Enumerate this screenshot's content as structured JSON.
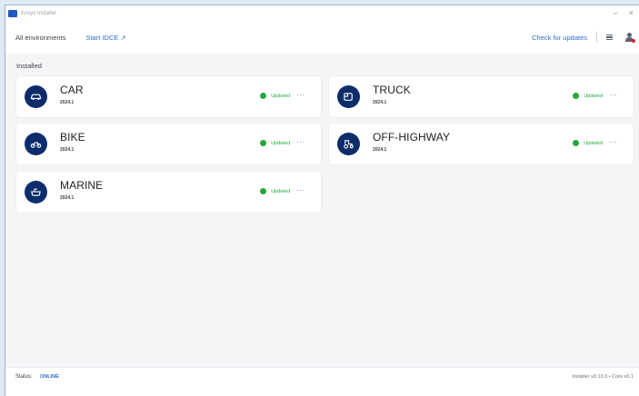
{
  "window": {
    "title": "Ansys Installer",
    "controls": {
      "minimize": "–",
      "close": "×"
    }
  },
  "topbar": {
    "all_environments": "All environments",
    "start_link": "Start IDCE ↗",
    "check_updates": "Check for updates"
  },
  "section": {
    "title": "Installed"
  },
  "cards": [
    {
      "name": "CAR",
      "version": "2024.1",
      "status": "Updated",
      "more": "···",
      "icon": "car-icon"
    },
    {
      "name": "TRUCK",
      "version": "2024.1",
      "status": "Updated",
      "more": "···",
      "icon": "truck-icon"
    },
    {
      "name": "BIKE",
      "version": "2024.1",
      "status": "Updated",
      "more": "···",
      "icon": "bike-icon"
    },
    {
      "name": "OFF-HIGHWAY",
      "version": "2024.1",
      "status": "Updated",
      "more": "···",
      "icon": "off-highway-icon"
    },
    {
      "name": "MARINE",
      "version": "2024.1",
      "status": "Updated",
      "more": "···",
      "icon": "marine-icon"
    }
  ],
  "statusbar": {
    "label": "Status:",
    "value": "ONLINE",
    "version_info": "Installer v0.13.0 • Core v0.1"
  },
  "colors": {
    "accent": "#2c6ec9",
    "badge": "#0c2c6b",
    "success": "#22a83e"
  }
}
